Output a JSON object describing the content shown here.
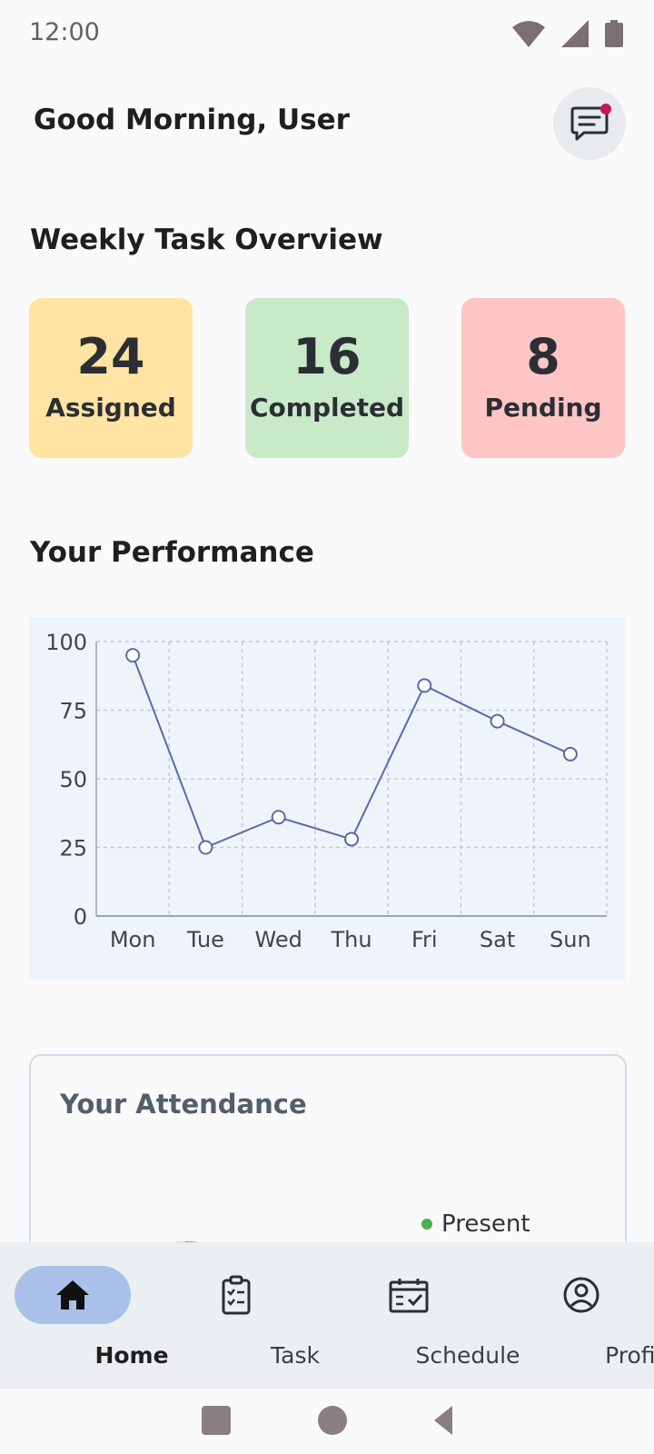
{
  "status": {
    "time": "12:00"
  },
  "header": {
    "greeting": "Good Morning, User"
  },
  "weekly": {
    "title": "Weekly Task Overview",
    "cards": [
      {
        "value": "24",
        "label": "Assigned",
        "color": "#ffe4a3"
      },
      {
        "value": "16",
        "label": "Completed",
        "color": "#c8eac9"
      },
      {
        "value": "8",
        "label": "Pending",
        "color": "#ffc5c5"
      }
    ]
  },
  "performance": {
    "title": "Your Performance"
  },
  "chart_data": {
    "type": "line",
    "categories": [
      "Mon",
      "Tue",
      "Wed",
      "Thu",
      "Fri",
      "Sat",
      "Sun"
    ],
    "series": [
      {
        "values": [
          95,
          25,
          36,
          28,
          84,
          71,
          59
        ],
        "color": "#5b6aa8"
      }
    ],
    "ylim": [
      0,
      100
    ],
    "yticks": [
      "0",
      "25",
      "50",
      "75",
      "100"
    ],
    "grid": true,
    "title": "",
    "xlabel": "",
    "ylabel": ""
  },
  "attendance": {
    "title": "Your Attendance",
    "legend": [
      {
        "label": "Present",
        "color": "#4caf50"
      }
    ]
  },
  "nav": {
    "items": [
      {
        "label": "Home",
        "icon": "home-icon",
        "active": true
      },
      {
        "label": "Task",
        "icon": "clipboard-icon",
        "active": false
      },
      {
        "label": "Schedule",
        "icon": "calendar-icon",
        "active": false
      },
      {
        "label": "Profile",
        "icon": "profile-icon",
        "active": false
      }
    ]
  }
}
